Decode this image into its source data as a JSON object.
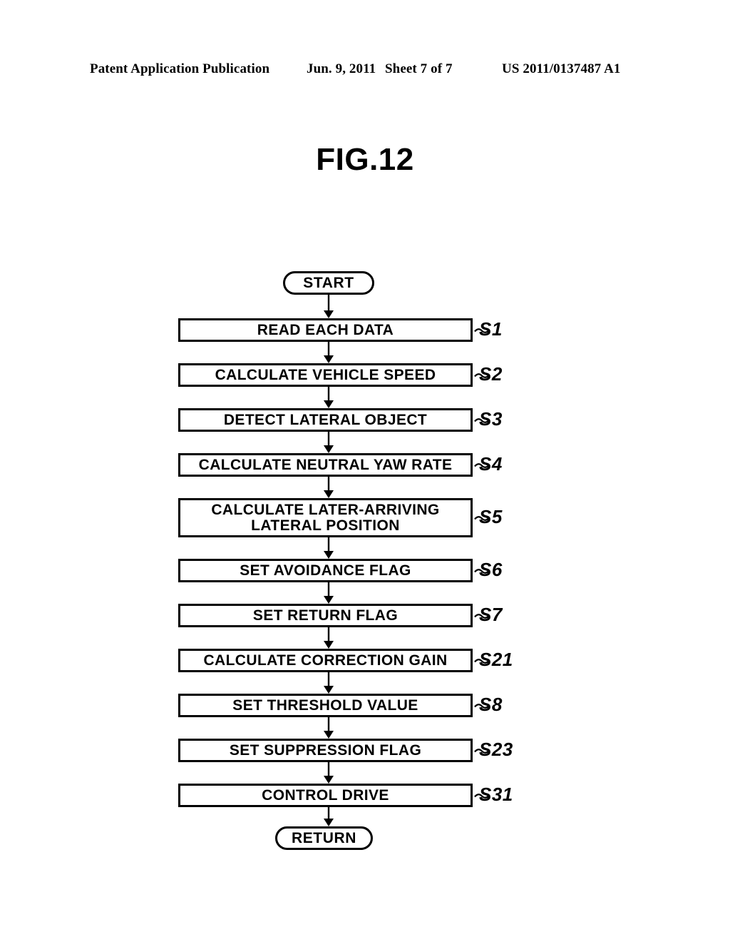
{
  "header": {
    "publication": "Patent Application Publication",
    "date": "Jun. 9, 2011",
    "sheet": "Sheet 7 of 7",
    "number": "US 2011/0137487 A1"
  },
  "figure": {
    "title": "FIG.12"
  },
  "flowchart": {
    "start_label": "START",
    "return_label": "RETURN",
    "connector_symbol": "~",
    "line_color": "#000000",
    "fill_color": "#ffffff",
    "steps": [
      {
        "ref": "S1",
        "line1": "READ EACH DATA",
        "line2": ""
      },
      {
        "ref": "S2",
        "line1": "CALCULATE VEHICLE SPEED",
        "line2": ""
      },
      {
        "ref": "S3",
        "line1": "DETECT LATERAL OBJECT",
        "line2": ""
      },
      {
        "ref": "S4",
        "line1": "CALCULATE NEUTRAL YAW RATE",
        "line2": ""
      },
      {
        "ref": "S5",
        "line1": "CALCULATE LATER-ARRIVING",
        "line2": "LATERAL POSITION"
      },
      {
        "ref": "S6",
        "line1": "SET AVOIDANCE FLAG",
        "line2": ""
      },
      {
        "ref": "S7",
        "line1": "SET RETURN FLAG",
        "line2": ""
      },
      {
        "ref": "S21",
        "line1": "CALCULATE CORRECTION GAIN",
        "line2": ""
      },
      {
        "ref": "S8",
        "line1": "SET THRESHOLD VALUE",
        "line2": ""
      },
      {
        "ref": "S23",
        "line1": "SET SUPPRESSION FLAG",
        "line2": ""
      },
      {
        "ref": "S31",
        "line1": "CONTROL DRIVE",
        "line2": ""
      }
    ]
  }
}
